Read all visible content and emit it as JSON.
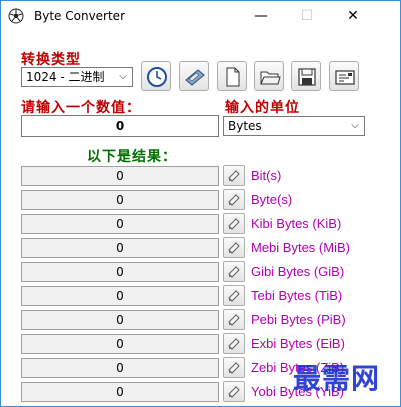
{
  "window": {
    "title": "Byte Converter",
    "minimize_glyph": "—",
    "maximize_glyph": "☐",
    "close_glyph": "✕"
  },
  "conversion": {
    "type_label": "转换类型",
    "type_selected": "1024 - 二进制"
  },
  "toolbar": {
    "icons": [
      "clock-icon",
      "calculator-icon",
      "new-document-icon",
      "open-folder-icon",
      "save-icon",
      "display-icon"
    ]
  },
  "input": {
    "value_label": "请输入一个数值：",
    "value": "0",
    "unit_label": "输入的单位",
    "unit_selected": "Bytes"
  },
  "results": {
    "heading": "以下是结果：",
    "rows": [
      {
        "value": "0",
        "unit": "Bit(s)"
      },
      {
        "value": "0",
        "unit": "Byte(s)"
      },
      {
        "value": "0",
        "unit": "Kibi Bytes (KiB)"
      },
      {
        "value": "0",
        "unit": "Mebi Bytes (MiB)"
      },
      {
        "value": "0",
        "unit": "Gibi Bytes (GiB)"
      },
      {
        "value": "0",
        "unit": "Tebi Bytes (TiB)"
      },
      {
        "value": "0",
        "unit": "Pebi Bytes (PiB)"
      },
      {
        "value": "0",
        "unit": "Exbi Bytes (EiB)"
      },
      {
        "value": "0",
        "unit": "Zebi Bytes (ZiB)"
      },
      {
        "value": "0",
        "unit": "Yobi Bytes (YiB)"
      }
    ]
  },
  "watermark": "最需网",
  "colors": {
    "label_red": "#c00000",
    "label_green": "#007000",
    "unit_purple": "#b000b0",
    "watermark_blue": "#1a2fd0"
  }
}
